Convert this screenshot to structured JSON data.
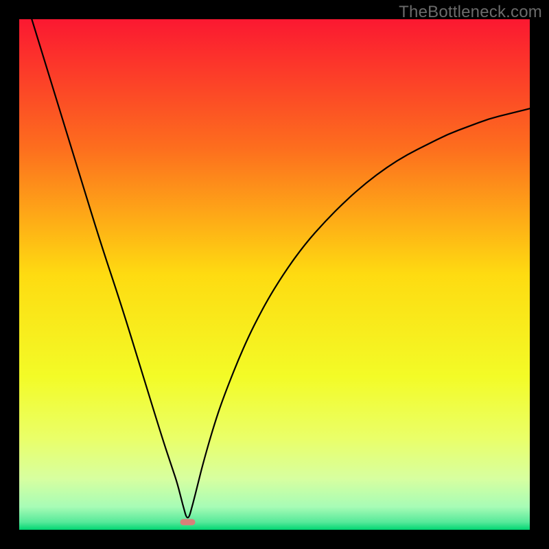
{
  "watermark": "TheBottleneck.com",
  "chart_data": {
    "type": "line",
    "title": "",
    "xlabel": "",
    "ylabel": "",
    "xlim": [
      0,
      100
    ],
    "ylim": [
      0,
      100
    ],
    "grid": false,
    "legend": false,
    "annotations": [],
    "optimum_x": 33,
    "gradient": {
      "stops": [
        {
          "pos": 0.0,
          "color": "#fb1831"
        },
        {
          "pos": 0.25,
          "color": "#fd6d1e"
        },
        {
          "pos": 0.5,
          "color": "#fedb11"
        },
        {
          "pos": 0.7,
          "color": "#f3fb27"
        },
        {
          "pos": 0.82,
          "color": "#eaff68"
        },
        {
          "pos": 0.9,
          "color": "#d7ffa0"
        },
        {
          "pos": 0.955,
          "color": "#a7fcb6"
        },
        {
          "pos": 0.985,
          "color": "#56e99a"
        },
        {
          "pos": 1.0,
          "color": "#00d672"
        }
      ]
    },
    "series": [
      {
        "name": "bottleneck-curve",
        "color": "#000000",
        "x": [
          0,
          4,
          8,
          12,
          16,
          20,
          24,
          28,
          30,
          31,
          32,
          33,
          34,
          35,
          36,
          38,
          40,
          44,
          48,
          52,
          56,
          60,
          64,
          68,
          72,
          76,
          80,
          84,
          88,
          92,
          96,
          100
        ],
        "values": [
          108,
          95,
          82,
          69,
          56,
          44,
          31,
          18,
          12,
          9,
          5,
          1.5,
          5,
          9,
          13,
          20,
          26,
          36,
          44,
          50.5,
          56,
          60.5,
          64.5,
          68,
          71,
          73.5,
          75.5,
          77.5,
          79,
          80.5,
          81.5,
          82.5
        ]
      }
    ],
    "marker": {
      "x": 33,
      "y": 1.5,
      "color": "#d88079",
      "shape": "rounded-bar"
    }
  }
}
